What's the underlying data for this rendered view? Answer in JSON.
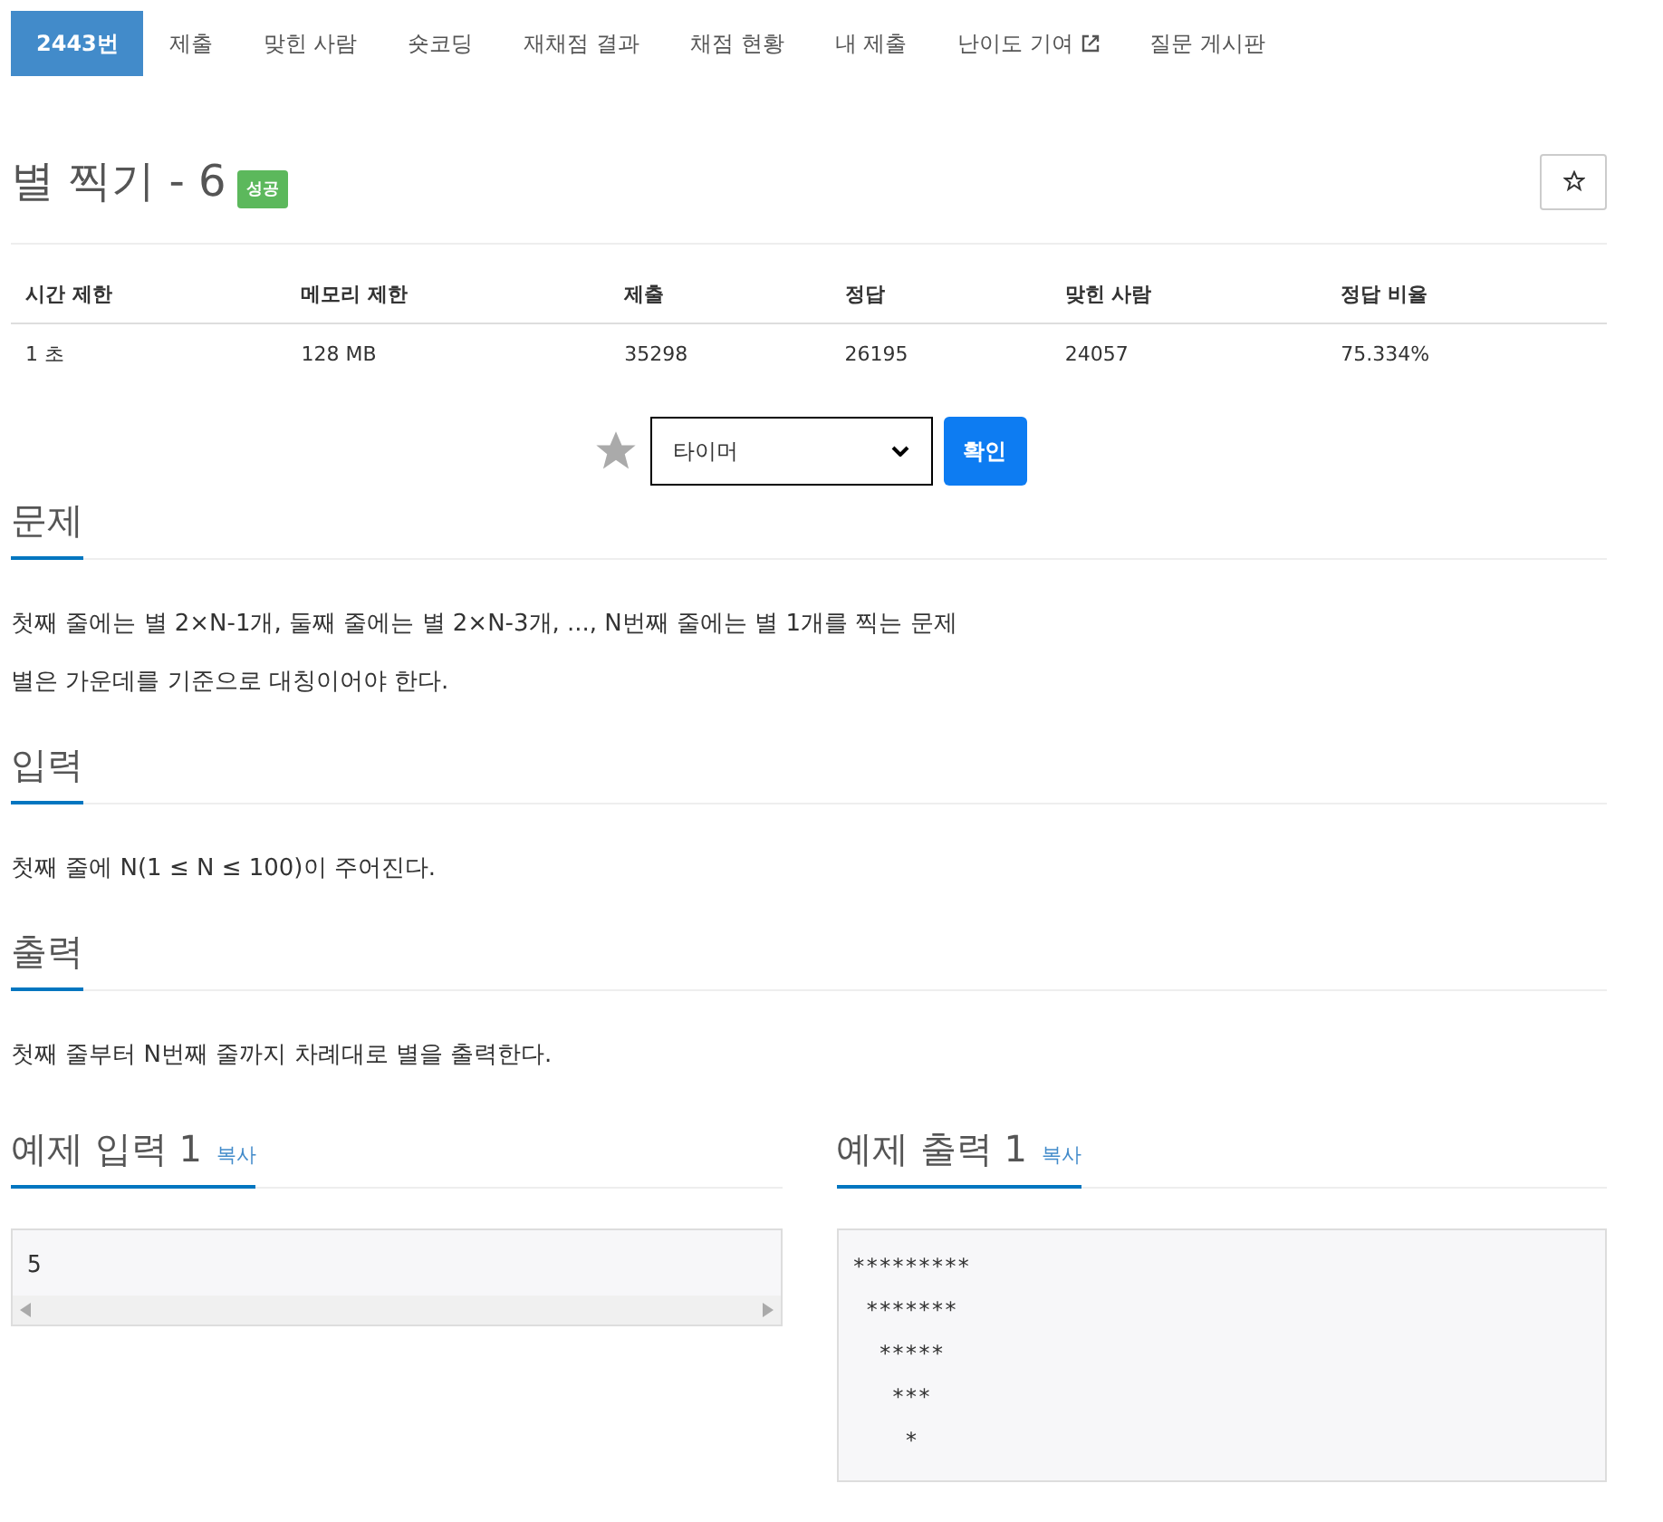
{
  "tabs": [
    {
      "label": "2443번",
      "selected": true,
      "external": false
    },
    {
      "label": "제출",
      "selected": false,
      "external": false
    },
    {
      "label": "맞힌 사람",
      "selected": false,
      "external": false
    },
    {
      "label": "숏코딩",
      "selected": false,
      "external": false
    },
    {
      "label": "재채점 결과",
      "selected": false,
      "external": false
    },
    {
      "label": "채점 현황",
      "selected": false,
      "external": false
    },
    {
      "label": "내 제출",
      "selected": false,
      "external": false
    },
    {
      "label": "난이도 기여",
      "selected": false,
      "external": true
    },
    {
      "label": "질문 게시판",
      "selected": false,
      "external": false
    }
  ],
  "title": "별 찍기 - 6",
  "status_badge": "성공",
  "table": {
    "columns": [
      "시간 제한",
      "메모리 제한",
      "제출",
      "정답",
      "맞힌 사람",
      "정답 비율"
    ],
    "rows": [
      [
        "1 초",
        "128 MB",
        "35298",
        "26195",
        "24057",
        "75.334%"
      ]
    ]
  },
  "timer": {
    "select_value": "타이머",
    "button": "확인"
  },
  "sections": [
    {
      "heading": "문제",
      "paragraphs": [
        "첫째 줄에는 별 2×N-1개, 둘째 줄에는 별 2×N-3개, ..., N번째 줄에는 별 1개를 찍는 문제",
        "별은 가운데를 기준으로 대칭이어야 한다."
      ]
    },
    {
      "heading": "입력",
      "paragraphs": [
        "첫째 줄에 N(1 ≤ N ≤ 100)이 주어진다."
      ]
    },
    {
      "heading": "출력",
      "paragraphs": [
        "첫째 줄부터 N번째 줄까지 차례대로 별을 출력한다."
      ]
    }
  ],
  "samples": [
    {
      "heading": "예제 입력 1",
      "copy": "복사",
      "lines": [
        "5"
      ],
      "scrollbar": true
    },
    {
      "heading": "예제 출력 1",
      "copy": "복사",
      "lines": [
        "*********",
        " *******",
        "  *****",
        "   ***",
        "    *"
      ],
      "scrollbar": false
    }
  ]
}
